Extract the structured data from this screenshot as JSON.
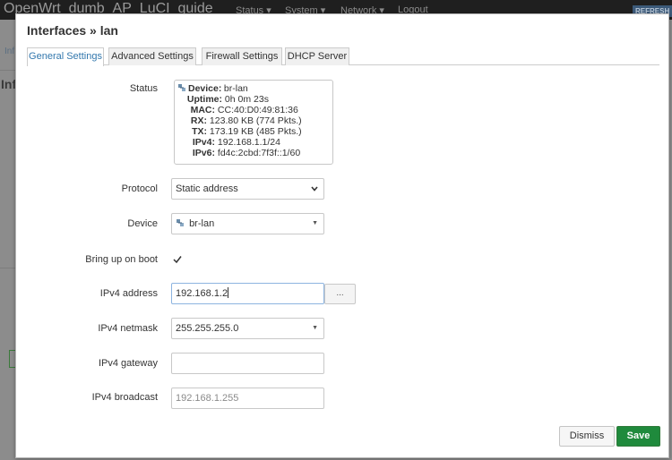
{
  "background": {
    "brand": "OpenWrt_dumb_AP_LuCI_guide",
    "nav": [
      "Status ▾",
      "System ▾",
      "Network ▾",
      "Logout"
    ],
    "refresh_label": "REFRESH",
    "crumb": "Inf",
    "title": "Inf"
  },
  "modal": {
    "title": "Interfaces » lan",
    "tabs": [
      {
        "label": "General Settings",
        "active": true
      },
      {
        "label": "Advanced Settings",
        "active": false
      },
      {
        "label": "Firewall Settings",
        "active": false
      },
      {
        "label": "DHCP Server",
        "active": false
      }
    ],
    "status": {
      "label": "Status",
      "lines": [
        {
          "key": "Device:",
          "value": "br-lan"
        },
        {
          "key": "Uptime:",
          "value": "0h 0m 23s"
        },
        {
          "key": "MAC:",
          "value": "CC:40:D0:49:81:36"
        },
        {
          "key": "RX:",
          "value": "123.80 KB (774 Pkts.)"
        },
        {
          "key": "TX:",
          "value": "173.19 KB (485 Pkts.)"
        },
        {
          "key": "IPv4:",
          "value": "192.168.1.1/24"
        },
        {
          "key": "IPv6:",
          "value": "fd4c:2cbd:7f3f::1/60"
        }
      ]
    },
    "protocol": {
      "label": "Protocol",
      "value": "Static address"
    },
    "device": {
      "label": "Device",
      "value": "br-lan"
    },
    "boot": {
      "label": "Bring up on boot",
      "checked": true
    },
    "ipv4_address": {
      "label": "IPv4 address",
      "value": "192.168.1.2",
      "more": "..."
    },
    "ipv4_netmask": {
      "label": "IPv4 netmask",
      "value": "255.255.255.0"
    },
    "ipv4_gateway": {
      "label": "IPv4 gateway",
      "value": ""
    },
    "ipv4_broadcast": {
      "label": "IPv4 broadcast",
      "placeholder": "192.168.1.255"
    },
    "buttons": {
      "dismiss": "Dismiss",
      "save": "Save"
    }
  },
  "colors": {
    "accent": "#3277ad",
    "save": "#1f8a3c",
    "focus": "#8db4e0"
  }
}
